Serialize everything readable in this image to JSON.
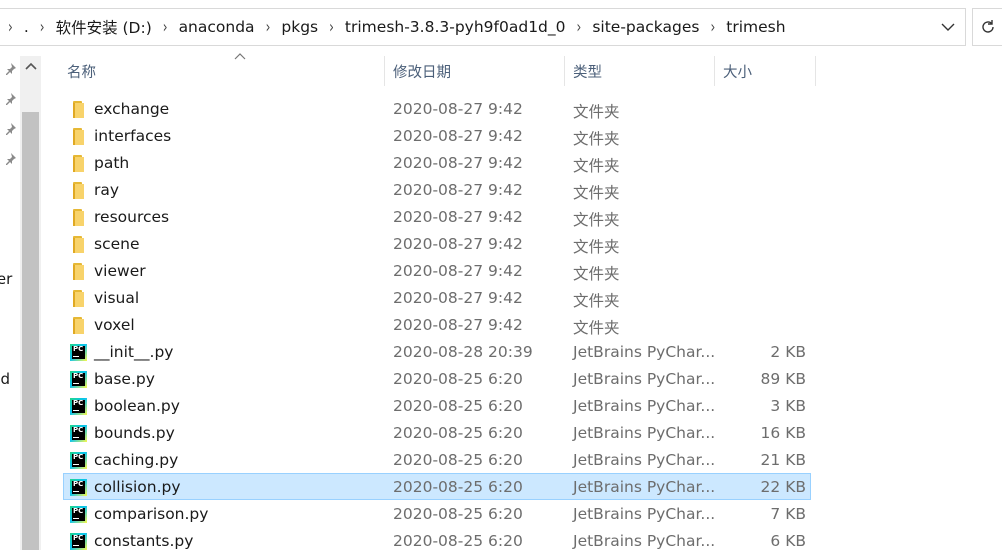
{
  "address": {
    "crumbs": [
      ".",
      "软件安装 (D:)",
      "anaconda",
      "pkgs",
      "trimesh-3.8.3-pyh9f0ad1d_0",
      "site-packages",
      "trimesh"
    ]
  },
  "nav": {
    "partial_labels": [
      "ter",
      "ud"
    ]
  },
  "columns": {
    "name": "名称",
    "date": "修改日期",
    "type": "类型",
    "size": "大小"
  },
  "files": [
    {
      "name": "exchange",
      "date": "2020-08-27 9:42",
      "type": "文件夹",
      "size": "",
      "kind": "folder"
    },
    {
      "name": "interfaces",
      "date": "2020-08-27 9:42",
      "type": "文件夹",
      "size": "",
      "kind": "folder"
    },
    {
      "name": "path",
      "date": "2020-08-27 9:42",
      "type": "文件夹",
      "size": "",
      "kind": "folder"
    },
    {
      "name": "ray",
      "date": "2020-08-27 9:42",
      "type": "文件夹",
      "size": "",
      "kind": "folder"
    },
    {
      "name": "resources",
      "date": "2020-08-27 9:42",
      "type": "文件夹",
      "size": "",
      "kind": "folder"
    },
    {
      "name": "scene",
      "date": "2020-08-27 9:42",
      "type": "文件夹",
      "size": "",
      "kind": "folder"
    },
    {
      "name": "viewer",
      "date": "2020-08-27 9:42",
      "type": "文件夹",
      "size": "",
      "kind": "folder"
    },
    {
      "name": "visual",
      "date": "2020-08-27 9:42",
      "type": "文件夹",
      "size": "",
      "kind": "folder"
    },
    {
      "name": "voxel",
      "date": "2020-08-27 9:42",
      "type": "文件夹",
      "size": "",
      "kind": "folder"
    },
    {
      "name": "__init__.py",
      "date": "2020-08-28 20:39",
      "type": "JetBrains PyChar...",
      "size": "2 KB",
      "kind": "py"
    },
    {
      "name": "base.py",
      "date": "2020-08-25 6:20",
      "type": "JetBrains PyChar...",
      "size": "89 KB",
      "kind": "py"
    },
    {
      "name": "boolean.py",
      "date": "2020-08-25 6:20",
      "type": "JetBrains PyChar...",
      "size": "3 KB",
      "kind": "py"
    },
    {
      "name": "bounds.py",
      "date": "2020-08-25 6:20",
      "type": "JetBrains PyChar...",
      "size": "16 KB",
      "kind": "py"
    },
    {
      "name": "caching.py",
      "date": "2020-08-25 6:20",
      "type": "JetBrains PyChar...",
      "size": "21 KB",
      "kind": "py"
    },
    {
      "name": "collision.py",
      "date": "2020-08-25 6:20",
      "type": "JetBrains PyChar...",
      "size": "22 KB",
      "kind": "py",
      "selected": true
    },
    {
      "name": "comparison.py",
      "date": "2020-08-25 6:20",
      "type": "JetBrains PyChar...",
      "size": "7 KB",
      "kind": "py"
    },
    {
      "name": "constants.py",
      "date": "2020-08-25 6:20",
      "type": "JetBrains PyChar...",
      "size": "6 KB",
      "kind": "py"
    }
  ],
  "icons": {
    "folder": "folder-icon",
    "py": "pycharm-file-icon",
    "pin": "pin-icon",
    "refresh": "refresh-icon",
    "dropdown": "chevron-down-icon"
  },
  "colors": {
    "selection_bg": "#cce8ff",
    "selection_border": "#99d1ff",
    "header_text": "#4c607a",
    "folder": "#f8d36b"
  }
}
